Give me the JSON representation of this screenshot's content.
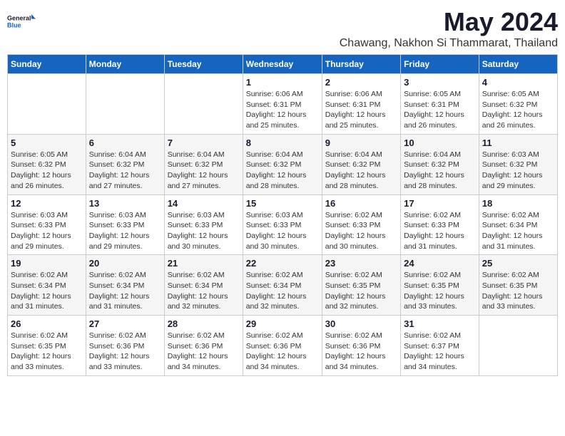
{
  "header": {
    "logo_line1": "General",
    "logo_line2": "Blue",
    "month": "May 2024",
    "location": "Chawang, Nakhon Si Thammarat, Thailand"
  },
  "weekdays": [
    "Sunday",
    "Monday",
    "Tuesday",
    "Wednesday",
    "Thursday",
    "Friday",
    "Saturday"
  ],
  "weeks": [
    [
      {
        "day": "",
        "info": ""
      },
      {
        "day": "",
        "info": ""
      },
      {
        "day": "",
        "info": ""
      },
      {
        "day": "1",
        "info": "Sunrise: 6:06 AM\nSunset: 6:31 PM\nDaylight: 12 hours\nand 25 minutes."
      },
      {
        "day": "2",
        "info": "Sunrise: 6:06 AM\nSunset: 6:31 PM\nDaylight: 12 hours\nand 25 minutes."
      },
      {
        "day": "3",
        "info": "Sunrise: 6:05 AM\nSunset: 6:31 PM\nDaylight: 12 hours\nand 26 minutes."
      },
      {
        "day": "4",
        "info": "Sunrise: 6:05 AM\nSunset: 6:32 PM\nDaylight: 12 hours\nand 26 minutes."
      }
    ],
    [
      {
        "day": "5",
        "info": "Sunrise: 6:05 AM\nSunset: 6:32 PM\nDaylight: 12 hours\nand 26 minutes."
      },
      {
        "day": "6",
        "info": "Sunrise: 6:04 AM\nSunset: 6:32 PM\nDaylight: 12 hours\nand 27 minutes."
      },
      {
        "day": "7",
        "info": "Sunrise: 6:04 AM\nSunset: 6:32 PM\nDaylight: 12 hours\nand 27 minutes."
      },
      {
        "day": "8",
        "info": "Sunrise: 6:04 AM\nSunset: 6:32 PM\nDaylight: 12 hours\nand 28 minutes."
      },
      {
        "day": "9",
        "info": "Sunrise: 6:04 AM\nSunset: 6:32 PM\nDaylight: 12 hours\nand 28 minutes."
      },
      {
        "day": "10",
        "info": "Sunrise: 6:04 AM\nSunset: 6:32 PM\nDaylight: 12 hours\nand 28 minutes."
      },
      {
        "day": "11",
        "info": "Sunrise: 6:03 AM\nSunset: 6:32 PM\nDaylight: 12 hours\nand 29 minutes."
      }
    ],
    [
      {
        "day": "12",
        "info": "Sunrise: 6:03 AM\nSunset: 6:33 PM\nDaylight: 12 hours\nand 29 minutes."
      },
      {
        "day": "13",
        "info": "Sunrise: 6:03 AM\nSunset: 6:33 PM\nDaylight: 12 hours\nand 29 minutes."
      },
      {
        "day": "14",
        "info": "Sunrise: 6:03 AM\nSunset: 6:33 PM\nDaylight: 12 hours\nand 30 minutes."
      },
      {
        "day": "15",
        "info": "Sunrise: 6:03 AM\nSunset: 6:33 PM\nDaylight: 12 hours\nand 30 minutes."
      },
      {
        "day": "16",
        "info": "Sunrise: 6:02 AM\nSunset: 6:33 PM\nDaylight: 12 hours\nand 30 minutes."
      },
      {
        "day": "17",
        "info": "Sunrise: 6:02 AM\nSunset: 6:33 PM\nDaylight: 12 hours\nand 31 minutes."
      },
      {
        "day": "18",
        "info": "Sunrise: 6:02 AM\nSunset: 6:34 PM\nDaylight: 12 hours\nand 31 minutes."
      }
    ],
    [
      {
        "day": "19",
        "info": "Sunrise: 6:02 AM\nSunset: 6:34 PM\nDaylight: 12 hours\nand 31 minutes."
      },
      {
        "day": "20",
        "info": "Sunrise: 6:02 AM\nSunset: 6:34 PM\nDaylight: 12 hours\nand 31 minutes."
      },
      {
        "day": "21",
        "info": "Sunrise: 6:02 AM\nSunset: 6:34 PM\nDaylight: 12 hours\nand 32 minutes."
      },
      {
        "day": "22",
        "info": "Sunrise: 6:02 AM\nSunset: 6:34 PM\nDaylight: 12 hours\nand 32 minutes."
      },
      {
        "day": "23",
        "info": "Sunrise: 6:02 AM\nSunset: 6:35 PM\nDaylight: 12 hours\nand 32 minutes."
      },
      {
        "day": "24",
        "info": "Sunrise: 6:02 AM\nSunset: 6:35 PM\nDaylight: 12 hours\nand 33 minutes."
      },
      {
        "day": "25",
        "info": "Sunrise: 6:02 AM\nSunset: 6:35 PM\nDaylight: 12 hours\nand 33 minutes."
      }
    ],
    [
      {
        "day": "26",
        "info": "Sunrise: 6:02 AM\nSunset: 6:35 PM\nDaylight: 12 hours\nand 33 minutes."
      },
      {
        "day": "27",
        "info": "Sunrise: 6:02 AM\nSunset: 6:36 PM\nDaylight: 12 hours\nand 33 minutes."
      },
      {
        "day": "28",
        "info": "Sunrise: 6:02 AM\nSunset: 6:36 PM\nDaylight: 12 hours\nand 34 minutes."
      },
      {
        "day": "29",
        "info": "Sunrise: 6:02 AM\nSunset: 6:36 PM\nDaylight: 12 hours\nand 34 minutes."
      },
      {
        "day": "30",
        "info": "Sunrise: 6:02 AM\nSunset: 6:36 PM\nDaylight: 12 hours\nand 34 minutes."
      },
      {
        "day": "31",
        "info": "Sunrise: 6:02 AM\nSunset: 6:37 PM\nDaylight: 12 hours\nand 34 minutes."
      },
      {
        "day": "",
        "info": ""
      }
    ]
  ]
}
